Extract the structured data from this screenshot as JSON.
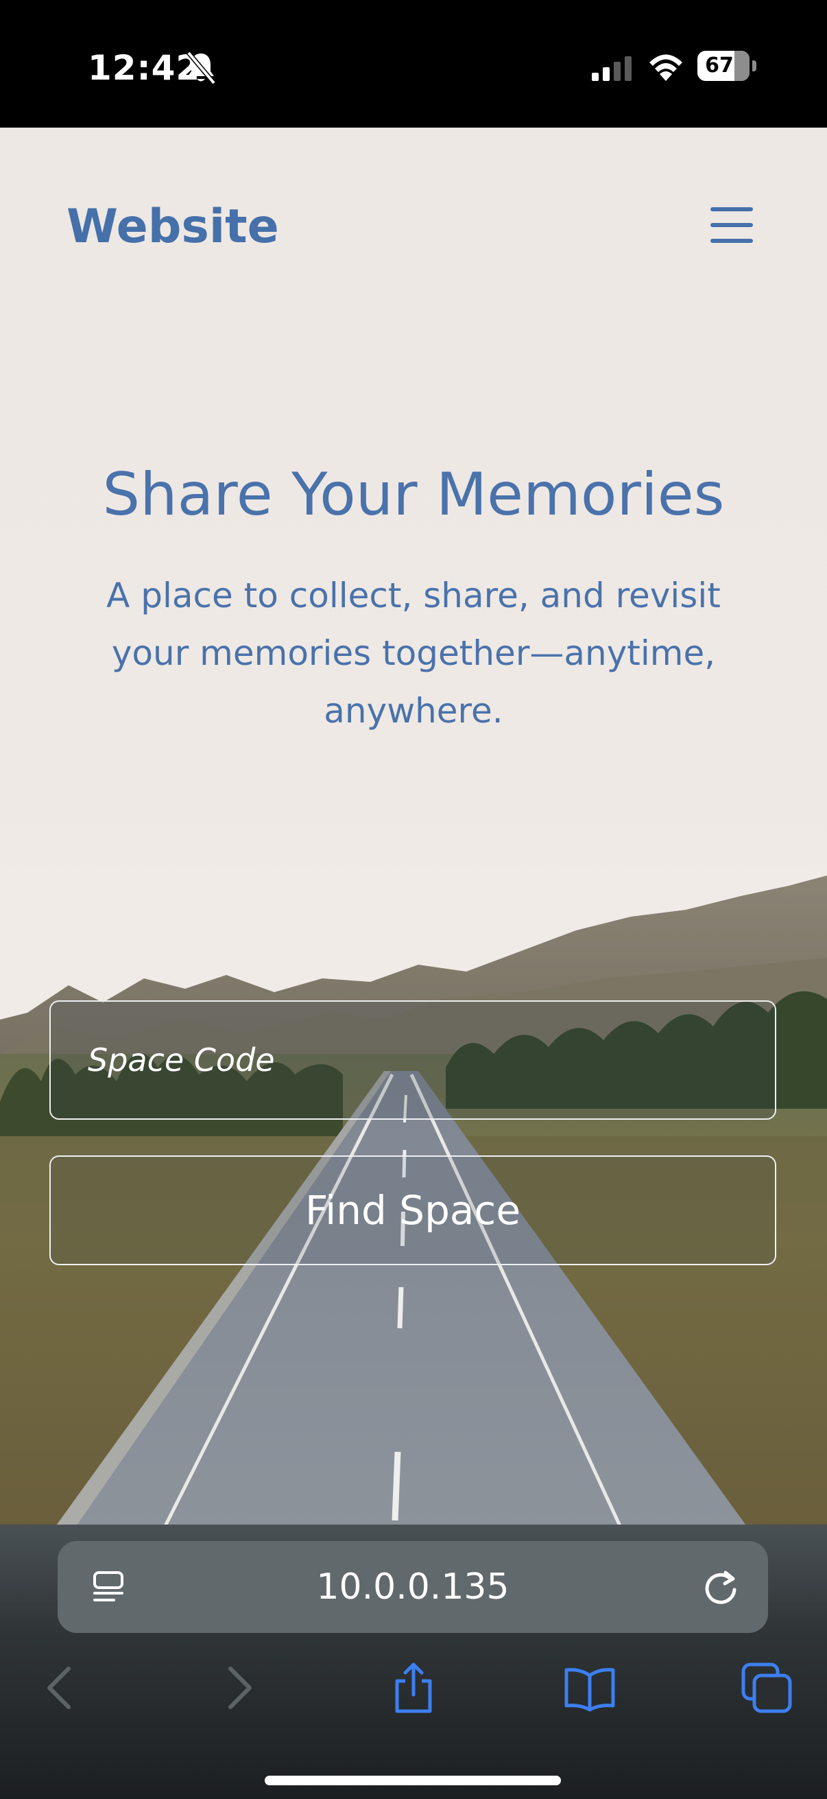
{
  "status_bar": {
    "time": "12:42",
    "battery_level": "67",
    "icons": [
      "bell-slash-icon",
      "cellular-signal-icon",
      "wifi-icon",
      "battery-icon"
    ]
  },
  "header": {
    "brand": "Website",
    "menu_icon": "hamburger-menu-icon"
  },
  "hero": {
    "title": "Share Your Memories",
    "subtitle": "A place to collect, share, and revisit your memories together—anytime, anywhere."
  },
  "form": {
    "space_code_placeholder": "Space Code",
    "space_code_value": "",
    "find_button_label": "Find Space"
  },
  "browser": {
    "url": "10.0.0.135",
    "toolbar_icons": [
      "back-icon",
      "forward-icon",
      "share-icon",
      "bookmarks-icon",
      "tabs-icon"
    ],
    "colors": {
      "accent": "#3d7ff0",
      "disabled": "#5c6367"
    }
  },
  "colors": {
    "brand": "#4570aa",
    "page_background": "#ede8e4"
  }
}
